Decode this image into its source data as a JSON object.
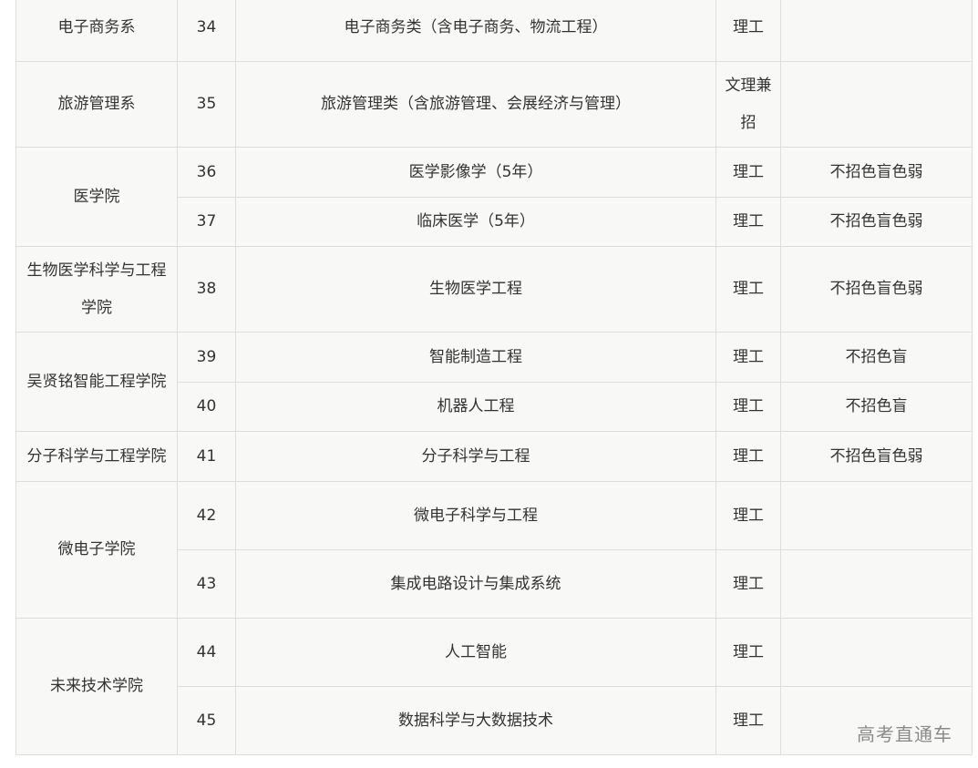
{
  "rows": [
    {
      "dept": "电子商务系",
      "no": "34",
      "major": "电子商务类（含电子商务、物流工程）",
      "category": "理工",
      "note": ""
    },
    {
      "dept": "旅游管理系",
      "no": "35",
      "major": "旅游管理类（含旅游管理、会展经济与管理）",
      "category": "文理兼招",
      "note": ""
    },
    {
      "dept": "医学院",
      "no": "36",
      "major": "医学影像学（5年）",
      "category": "理工",
      "note": "不招色盲色弱"
    },
    {
      "no": "37",
      "major": "临床医学（5年）",
      "category": "理工",
      "note": "不招色盲色弱"
    },
    {
      "dept": "生物医学科学与工程学院",
      "no": "38",
      "major": "生物医学工程",
      "category": "理工",
      "note": "不招色盲色弱"
    },
    {
      "dept": "吴贤铭智能工程学院",
      "no": "39",
      "major": "智能制造工程",
      "category": "理工",
      "note": "不招色盲"
    },
    {
      "no": "40",
      "major": "机器人工程",
      "category": "理工",
      "note": "不招色盲"
    },
    {
      "dept": "分子科学与工程学院",
      "no": "41",
      "major": "分子科学与工程",
      "category": "理工",
      "note": "不招色盲色弱"
    },
    {
      "dept": "微电子学院",
      "no": "42",
      "major": "微电子科学与工程",
      "category": "理工",
      "note": ""
    },
    {
      "no": "43",
      "major": "集成电路设计与集成系统",
      "category": "理工",
      "note": ""
    },
    {
      "dept": "未来技术学院",
      "no": "44",
      "major": "人工智能",
      "category": "理工",
      "note": ""
    },
    {
      "no": "45",
      "major": "数据科学与大数据技术",
      "category": "理工",
      "note": ""
    }
  ],
  "watermark": "高考直通车"
}
